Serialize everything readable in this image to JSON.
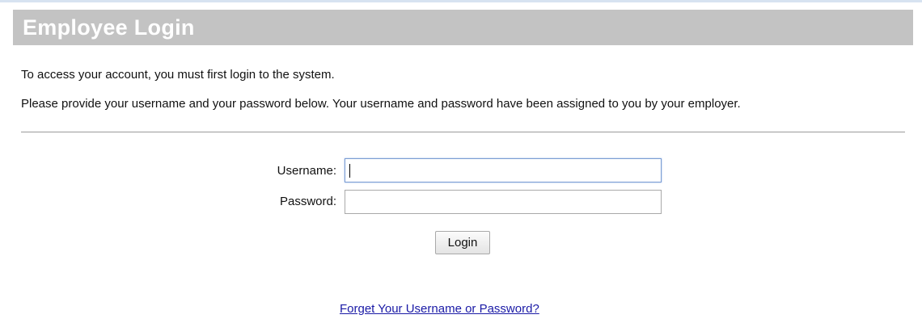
{
  "header": {
    "title": "Employee Login"
  },
  "intro": {
    "line1": "To access your account, you must first login to the system.",
    "line2": "Please provide your username and your password below. Your username and password have been assigned to you by your employer."
  },
  "form": {
    "username_label": "Username:",
    "username_value": "",
    "password_label": "Password:",
    "password_value": "",
    "login_label": "Login"
  },
  "links": {
    "forgot": "Forget Your Username or Password?"
  },
  "colors": {
    "title_bar": "#c3c3c3",
    "title_text": "#ffffff",
    "link": "#1a1aa6",
    "focus_border": "#7a9cd3"
  }
}
